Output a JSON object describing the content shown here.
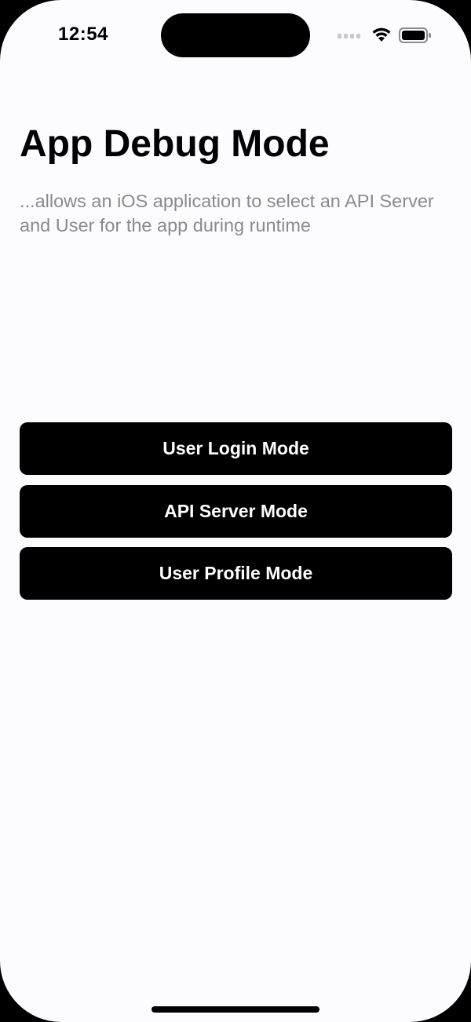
{
  "status_bar": {
    "time": "12:54",
    "icons": [
      "signal-icon",
      "wifi-icon",
      "battery-icon"
    ]
  },
  "main": {
    "title": "App Debug Mode",
    "subtitle": "...allows an iOS application to select an API Server and User for the app during runtime"
  },
  "buttons": [
    {
      "label": "User Login Mode"
    },
    {
      "label": "API Server Mode"
    },
    {
      "label": "User Profile Mode"
    }
  ],
  "colors": {
    "background": "#fcfbfe",
    "button_bg": "#000000",
    "button_text": "#ffffff",
    "subtitle": "#8a8a8e"
  }
}
